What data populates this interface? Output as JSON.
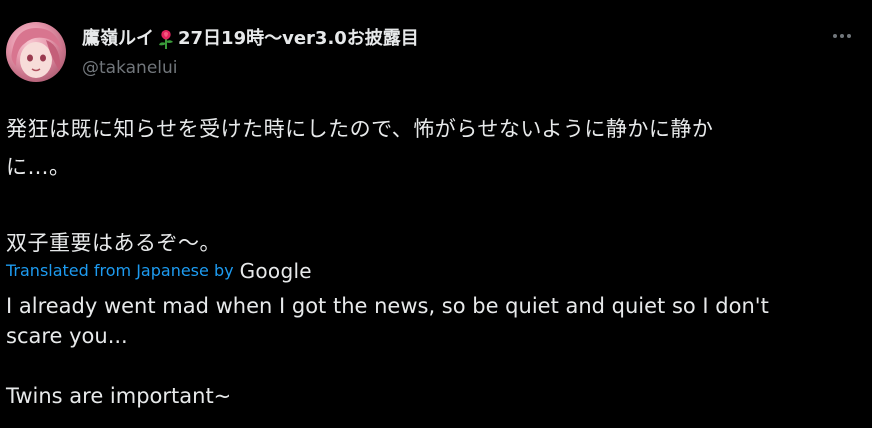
{
  "post": {
    "author": {
      "display_name": "鷹嶺ルイ",
      "name_suffix": "27日19時～ver3.0お披露目",
      "emoji": "rose-emoji",
      "handle": "@takanelui"
    },
    "more_icon": "more-options-icon",
    "original_text": {
      "line1": "発狂は既に知らせを受けた時にしたので、怖がらせないように静かに静か",
      "line2": "に…。",
      "line3": "双子重要はあるぞ〜。"
    },
    "translated_by": {
      "label": "Translated from Japanese by",
      "provider": "Google"
    },
    "translation_text": {
      "line1": "I already went mad when I got the news, so be quiet and quiet so I don't",
      "line2": "scare you...",
      "line3": "Twins are important~"
    }
  },
  "colors": {
    "background": "#000000",
    "text_primary": "#e7e9ea",
    "text_secondary": "#71767b",
    "link": "#1d9bf0"
  }
}
